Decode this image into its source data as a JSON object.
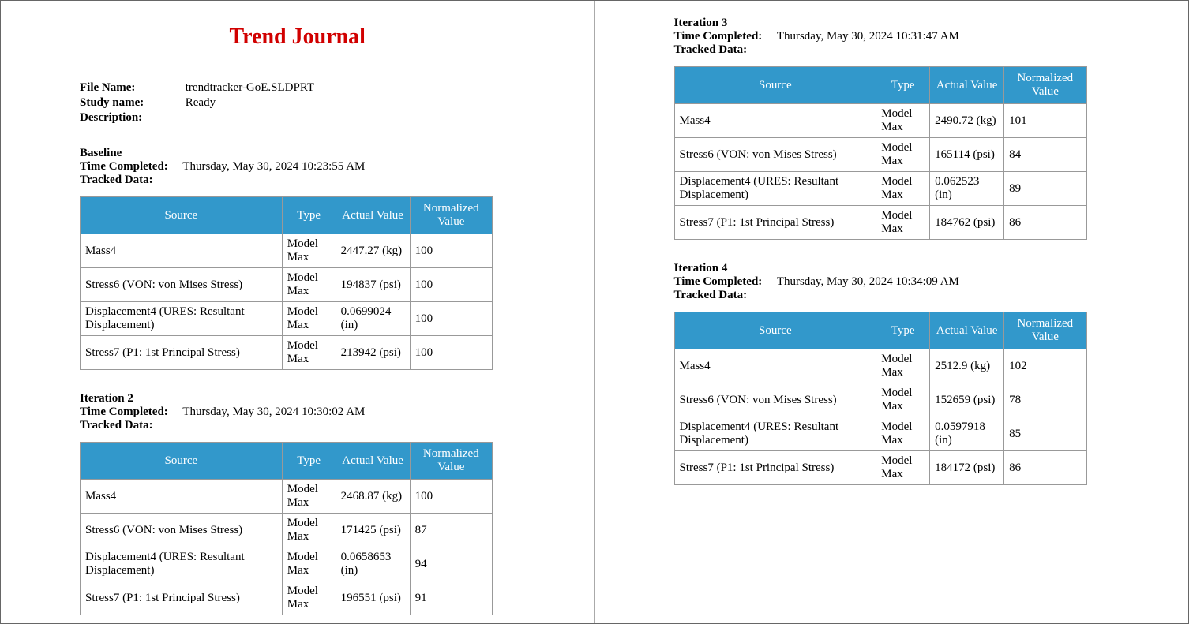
{
  "report_title": "Trend Journal",
  "meta": {
    "file_name_label": "File Name:",
    "file_name": "trendtracker-GoE.SLDPRT",
    "study_name_label": "Study name:",
    "study_name": "Ready",
    "description_label": "Description:",
    "description": "",
    "time_completed_label": "Time Completed:",
    "tracked_data_label": "Tracked Data:"
  },
  "columns": {
    "source": "Source",
    "type": "Type",
    "actual": "Actual Value",
    "normalized": "Normalized Value"
  },
  "sections": [
    {
      "name": "Baseline",
      "time": "Thursday, May 30, 2024 10:23:55 AM",
      "rows": [
        {
          "source": "Mass4",
          "type": "Model Max",
          "actual": "2447.27 (kg)",
          "norm": "100"
        },
        {
          "source": "Stress6 (VON: von Mises Stress)",
          "type": "Model Max",
          "actual": "194837 (psi)",
          "norm": "100"
        },
        {
          "source": "Displacement4 (URES: Resultant Displacement)",
          "type": "Model Max",
          "actual": "0.0699024 (in)",
          "norm": "100"
        },
        {
          "source": "Stress7 (P1: 1st Principal Stress)",
          "type": "Model Max",
          "actual": "213942 (psi)",
          "norm": "100"
        }
      ]
    },
    {
      "name": "Iteration 2",
      "time": "Thursday, May 30, 2024 10:30:02 AM",
      "rows": [
        {
          "source": "Mass4",
          "type": "Model Max",
          "actual": "2468.87 (kg)",
          "norm": "100"
        },
        {
          "source": "Stress6 (VON: von Mises Stress)",
          "type": "Model Max",
          "actual": "171425 (psi)",
          "norm": "87"
        },
        {
          "source": "Displacement4 (URES: Resultant Displacement)",
          "type": "Model Max",
          "actual": "0.0658653 (in)",
          "norm": "94"
        },
        {
          "source": "Stress7 (P1: 1st Principal Stress)",
          "type": "Model Max",
          "actual": "196551 (psi)",
          "norm": "91"
        }
      ]
    },
    {
      "name": "Iteration 3",
      "time": "Thursday, May 30, 2024 10:31:47 AM",
      "rows": [
        {
          "source": "Mass4",
          "type": "Model Max",
          "actual": "2490.72 (kg)",
          "norm": "101"
        },
        {
          "source": "Stress6 (VON: von Mises Stress)",
          "type": "Model Max",
          "actual": "165114 (psi)",
          "norm": "84"
        },
        {
          "source": "Displacement4 (URES: Resultant Displacement)",
          "type": "Model Max",
          "actual": "0.062523 (in)",
          "norm": "89"
        },
        {
          "source": "Stress7 (P1: 1st Principal Stress)",
          "type": "Model Max",
          "actual": "184762 (psi)",
          "norm": "86"
        }
      ]
    },
    {
      "name": "Iteration 4",
      "time": "Thursday, May 30, 2024 10:34:09 AM",
      "rows": [
        {
          "source": "Mass4",
          "type": "Model Max",
          "actual": "2512.9 (kg)",
          "norm": "102"
        },
        {
          "source": "Stress6 (VON: von Mises Stress)",
          "type": "Model Max",
          "actual": "152659 (psi)",
          "norm": "78"
        },
        {
          "source": "Displacement4 (URES: Resultant Displacement)",
          "type": "Model Max",
          "actual": "0.0597918 (in)",
          "norm": "85"
        },
        {
          "source": "Stress7 (P1: 1st Principal Stress)",
          "type": "Model Max",
          "actual": "184172 (psi)",
          "norm": "86"
        }
      ]
    }
  ]
}
